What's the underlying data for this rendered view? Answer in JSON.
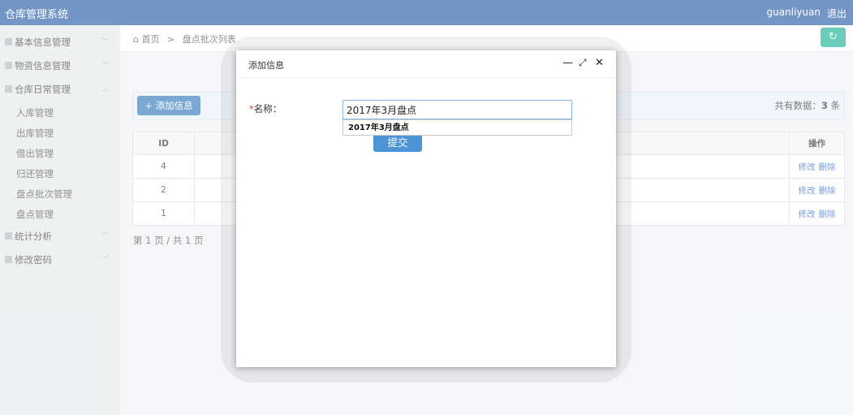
{
  "app": {
    "title": "仓库管理系统",
    "user": "guanliyuan",
    "logout": "退出"
  },
  "sidebar": {
    "items": [
      {
        "label": "基本信息管理",
        "chevron": "﹀"
      },
      {
        "label": "物资信息管理",
        "chevron": "﹀"
      },
      {
        "label": "仓库日常管理",
        "chevron": "︿"
      }
    ],
    "sub_items": [
      "入库管理",
      "出库管理",
      "借出管理",
      "归还管理",
      "盘点批次管理",
      "盘点管理"
    ],
    "bottom_items": [
      {
        "label": "统计分析",
        "chevron": "﹀"
      },
      {
        "label": "修改密码",
        "chevron": "﹀"
      }
    ]
  },
  "breadcrumb": {
    "home": "首页",
    "separator": ">",
    "current": "盘点批次列表"
  },
  "toolbar": {
    "add_label": "添加信息",
    "total_prefix": "共有数据：",
    "total_count": "3",
    "total_suffix": " 条"
  },
  "table": {
    "headers": {
      "id": "ID",
      "ops": "操作"
    },
    "rows": [
      {
        "id": "4",
        "edit": "修改",
        "delete": "删除"
      },
      {
        "id": "2",
        "edit": "修改",
        "delete": "删除"
      },
      {
        "id": "1",
        "edit": "修改",
        "delete": "删除"
      }
    ]
  },
  "pager": "第 1 页 / 共 1 页",
  "dialog": {
    "title": "添加信息",
    "label_required": "*",
    "label": "名称：",
    "input_value": "2017年3月盘点",
    "suggestion": "2017年3月盘点",
    "submit": "提交"
  },
  "colors": {
    "header": "#2a5faa",
    "accent": "#337ab7",
    "refresh": "#1ab394"
  }
}
